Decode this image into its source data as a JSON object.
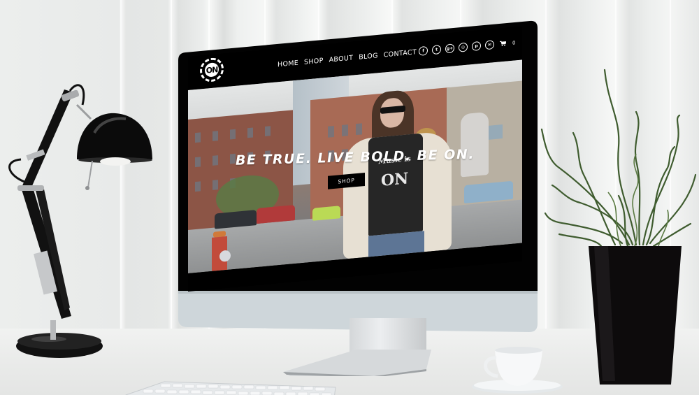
{
  "scene": {
    "description": "Desk scene with monitor showing fashion website, desk lamp, potted plant, coffee cup, keyboard"
  },
  "site": {
    "logo": {
      "text": "ON",
      "ring_text": "ORIGINAL NASHVILLE"
    },
    "nav": {
      "items": [
        {
          "label": "HOME"
        },
        {
          "label": "SHOP"
        },
        {
          "label": "ABOUT"
        },
        {
          "label": "BLOG"
        },
        {
          "label": "CONTACT"
        }
      ]
    },
    "social": [
      {
        "name": "facebook",
        "glyph": "f"
      },
      {
        "name": "twitter",
        "glyph": "t"
      },
      {
        "name": "google-plus",
        "glyph": "g+"
      },
      {
        "name": "instagram",
        "glyph": "◎"
      },
      {
        "name": "pinterest",
        "glyph": "p"
      },
      {
        "name": "email",
        "glyph": "✉"
      }
    ],
    "cart": {
      "glyph": "🛒",
      "count": "0"
    },
    "hero": {
      "tagline": "BE TRUE. LIVE BOLD. BE ON.",
      "button_label": "SHOP",
      "shirt_text_1": "Music is",
      "shirt_text_2": "ON"
    }
  },
  "colors": {
    "header_bg": "#000000",
    "nav_text": "#ffffff",
    "button_bg": "#000000",
    "monitor_chin": "#cfd5d9",
    "wall": "#eceeed"
  }
}
